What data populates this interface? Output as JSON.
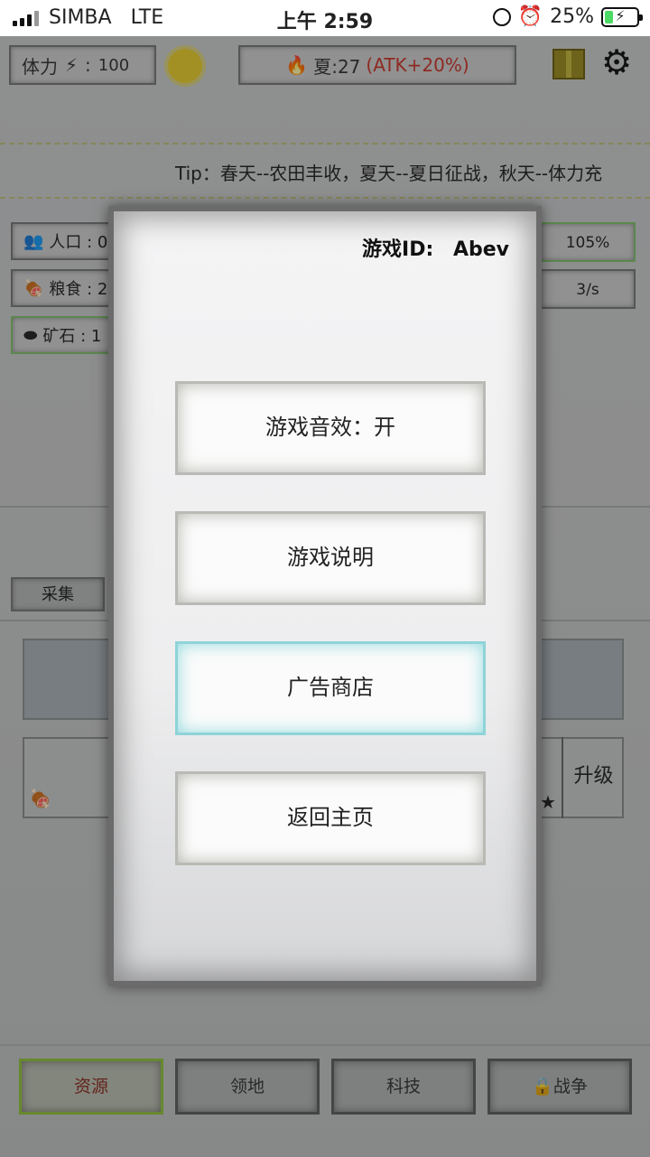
{
  "status_bar": {
    "carrier": "SIMBA",
    "network": "LTE",
    "time": "上午 2:59",
    "battery": "25%",
    "battery_fraction": 0.25
  },
  "header": {
    "stamina_label": "体力",
    "stamina_value": "100",
    "season_text": "夏:27",
    "season_bonus": "(ATK+20%)"
  },
  "tip": "Tip：春天--农田丰收，夏天--夏日征战，秋天--体力充",
  "resources": {
    "population_label": "人口 : 0",
    "food_label": "粮食 : 2",
    "ore_label": "矿石 : 1",
    "percent": "105%",
    "rate": "3/s"
  },
  "tabs_top": {
    "collect": "采集"
  },
  "slot": {
    "upgrade": "升级"
  },
  "bottom_tabs": [
    "资源",
    "领地",
    "科技",
    "战争"
  ],
  "modal": {
    "game_id_label": "游戏ID:",
    "game_id_value": "Abev",
    "buttons": [
      "游戏音效：开",
      "游戏说明",
      "广告商店",
      "返回主页"
    ]
  },
  "colors": {
    "season_accent": "#c8352a",
    "active_tab_border": "#8ec13c",
    "shop_button_border": "#8fd3d8"
  }
}
